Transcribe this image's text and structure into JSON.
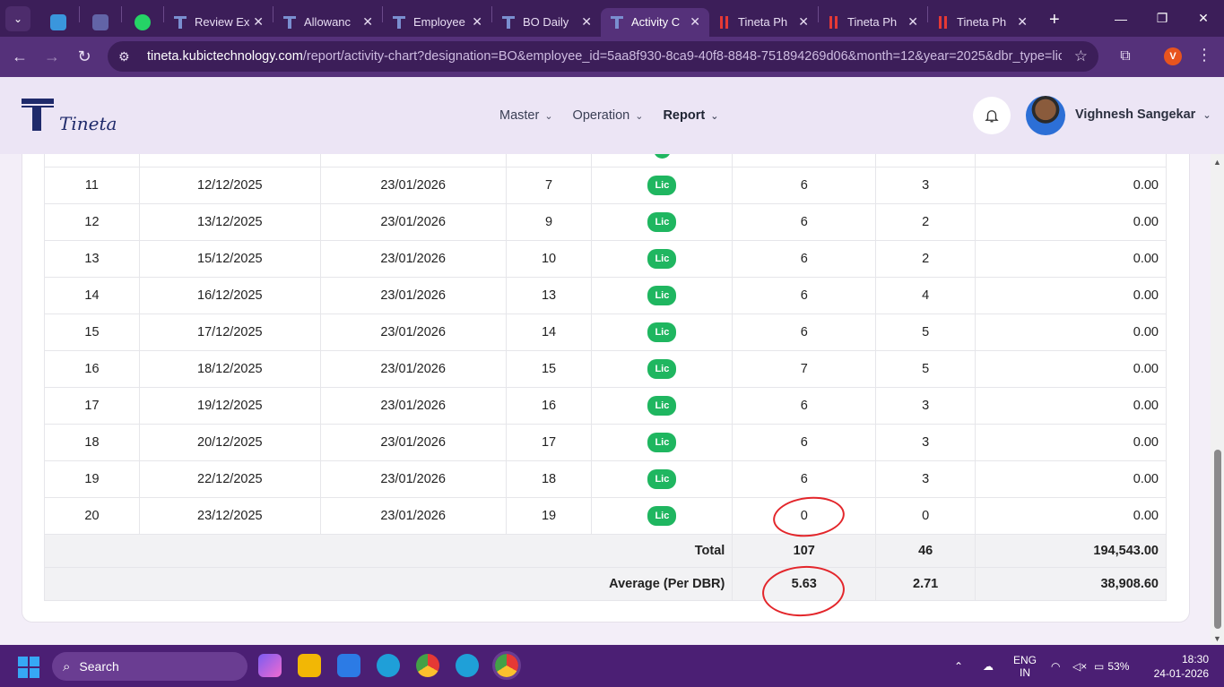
{
  "browser": {
    "tabs": [
      {
        "title": "",
        "icon": "outlook-icon",
        "pinned": true
      },
      {
        "title": "",
        "icon": "teams-icon",
        "pinned": true
      },
      {
        "title": "",
        "icon": "whatsapp-icon",
        "pinned": true
      },
      {
        "title": "Review Ex",
        "icon": "tineta-icon"
      },
      {
        "title": "Allowanc",
        "icon": "tineta-icon"
      },
      {
        "title": "Employee",
        "icon": "tineta-icon"
      },
      {
        "title": "BO Daily",
        "icon": "tineta-icon"
      },
      {
        "title": "Activity C",
        "icon": "tineta-icon",
        "active": true
      },
      {
        "title": "Tineta Ph",
        "icon": "pdf-icon"
      },
      {
        "title": "Tineta Ph",
        "icon": "pdf-icon"
      },
      {
        "title": "Tineta Ph",
        "icon": "pdf-icon"
      }
    ],
    "url_host": "tineta.kubictechnology.com",
    "url_path": "/report/activity-chart?designation=BO&employee_id=5aa8f930-8ca9-40f8-8848-751894269d06&month=12&year=2025&dbr_type=lic",
    "profile_initial": "V"
  },
  "app": {
    "logo_text": "Tineta",
    "nav": [
      {
        "label": "Master"
      },
      {
        "label": "Operation"
      },
      {
        "label": "Report",
        "active": true
      }
    ],
    "user_name": "Vighnesh Sangekar"
  },
  "table": {
    "rows": [
      {
        "no": "11",
        "date": "12/12/2025",
        "submitted": "23/01/2026",
        "count": "7",
        "type": "Lic",
        "a": "6",
        "b": "3",
        "amount": "0.00"
      },
      {
        "no": "12",
        "date": "13/12/2025",
        "submitted": "23/01/2026",
        "count": "9",
        "type": "Lic",
        "a": "6",
        "b": "2",
        "amount": "0.00"
      },
      {
        "no": "13",
        "date": "15/12/2025",
        "submitted": "23/01/2026",
        "count": "10",
        "type": "Lic",
        "a": "6",
        "b": "2",
        "amount": "0.00"
      },
      {
        "no": "14",
        "date": "16/12/2025",
        "submitted": "23/01/2026",
        "count": "13",
        "type": "Lic",
        "a": "6",
        "b": "4",
        "amount": "0.00"
      },
      {
        "no": "15",
        "date": "17/12/2025",
        "submitted": "23/01/2026",
        "count": "14",
        "type": "Lic",
        "a": "6",
        "b": "5",
        "amount": "0.00"
      },
      {
        "no": "16",
        "date": "18/12/2025",
        "submitted": "23/01/2026",
        "count": "15",
        "type": "Lic",
        "a": "7",
        "b": "5",
        "amount": "0.00"
      },
      {
        "no": "17",
        "date": "19/12/2025",
        "submitted": "23/01/2026",
        "count": "16",
        "type": "Lic",
        "a": "6",
        "b": "3",
        "amount": "0.00"
      },
      {
        "no": "18",
        "date": "20/12/2025",
        "submitted": "23/01/2026",
        "count": "17",
        "type": "Lic",
        "a": "6",
        "b": "3",
        "amount": "0.00"
      },
      {
        "no": "19",
        "date": "22/12/2025",
        "submitted": "23/01/2026",
        "count": "18",
        "type": "Lic",
        "a": "6",
        "b": "3",
        "amount": "0.00"
      },
      {
        "no": "20",
        "date": "23/12/2025",
        "submitted": "23/01/2026",
        "count": "19",
        "type": "Lic",
        "a": "0",
        "b": "0",
        "amount": "0.00"
      }
    ],
    "total": {
      "label": "Total",
      "a": "107",
      "b": "46",
      "amount": "194,543.00"
    },
    "average": {
      "label": "Average (Per DBR)",
      "a": "5.63",
      "b": "2.71",
      "amount": "38,908.60"
    }
  },
  "taskbar": {
    "search_placeholder": "Search",
    "lang_top": "ENG",
    "lang_bottom": "IN",
    "battery": "53%",
    "time": "18:30",
    "date": "24-01-2026"
  },
  "colors": {
    "badge_green": "#1fb660",
    "annotation_red": "#e3262b",
    "tab_bar": "#3c1e59",
    "taskbar": "#4b1f74"
  }
}
